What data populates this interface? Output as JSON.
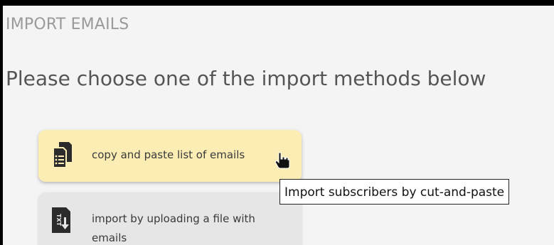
{
  "header": {
    "section_title": "IMPORT EMAILS",
    "subtitle": "Please choose one of the import methods below"
  },
  "methods": [
    {
      "label": "copy and paste list of emails",
      "icon": "clipboard-list-icon",
      "state": "hover",
      "color": "#fbedb4"
    },
    {
      "label": "import by uploading a file with emails",
      "icon": "txt-file-download-icon",
      "state": "normal",
      "color": "#e6e6e6"
    }
  ],
  "tooltip": {
    "text": "Import subscribers by cut-and-paste"
  },
  "cursor": {
    "icon": "hand-pointer-icon"
  }
}
